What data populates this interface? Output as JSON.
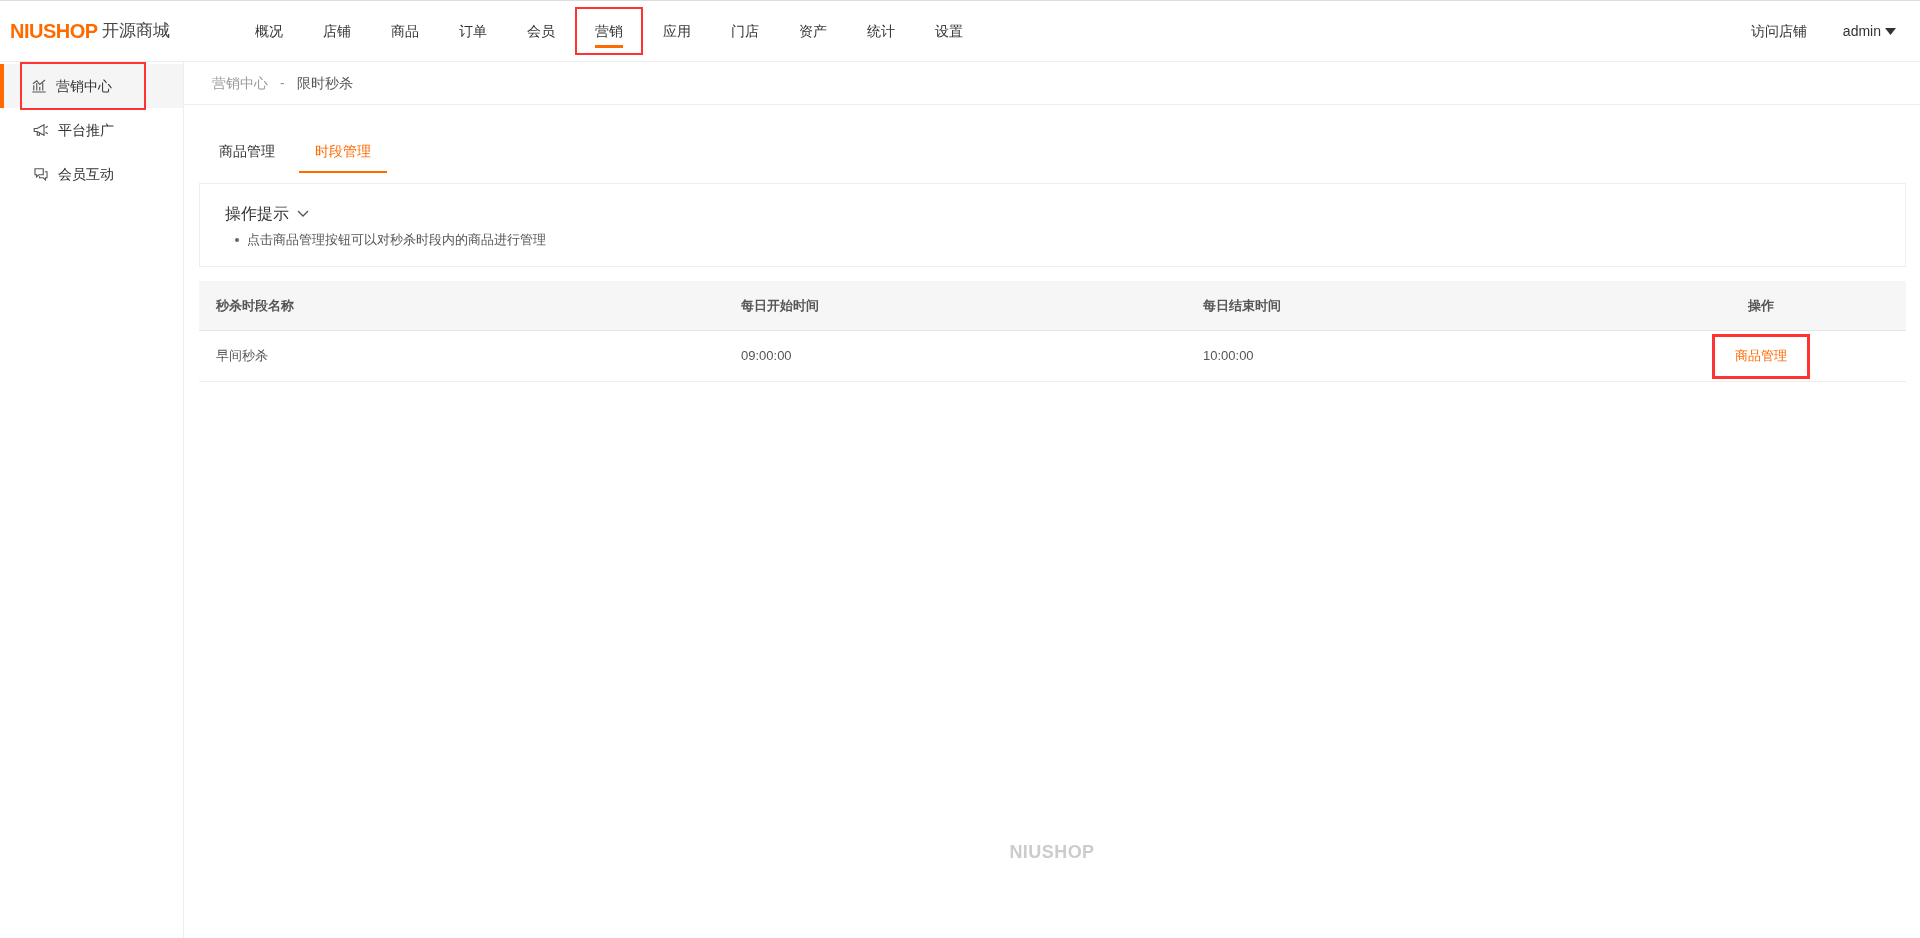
{
  "header": {
    "logo": {
      "brand": "NIUSHOP",
      "name": "开源商城"
    },
    "nav": [
      {
        "label": "概况",
        "selected": false,
        "highlighted": false
      },
      {
        "label": "店铺",
        "selected": false,
        "highlighted": false
      },
      {
        "label": "商品",
        "selected": false,
        "highlighted": false
      },
      {
        "label": "订单",
        "selected": false,
        "highlighted": false
      },
      {
        "label": "会员",
        "selected": false,
        "highlighted": false
      },
      {
        "label": "营销",
        "selected": true,
        "highlighted": true
      },
      {
        "label": "应用",
        "selected": false,
        "highlighted": false
      },
      {
        "label": "门店",
        "selected": false,
        "highlighted": false
      },
      {
        "label": "资产",
        "selected": false,
        "highlighted": false
      },
      {
        "label": "统计",
        "selected": false,
        "highlighted": false
      },
      {
        "label": "设置",
        "selected": false,
        "highlighted": false
      }
    ],
    "visit_store": "访问店铺",
    "user": "admin"
  },
  "sidebar": {
    "items": [
      {
        "label": "营销中心",
        "kind": "chart",
        "selected": true,
        "highlighted": true
      },
      {
        "label": "平台推广",
        "kind": "megaphone",
        "selected": false,
        "highlighted": false
      },
      {
        "label": "会员互动",
        "kind": "chat",
        "selected": false,
        "highlighted": false
      }
    ]
  },
  "breadcrumb": [
    "营销中心",
    "-",
    "限时秒杀"
  ],
  "tabs": [
    {
      "label": "商品管理",
      "selected": false
    },
    {
      "label": "时段管理",
      "selected": true
    }
  ],
  "tips": {
    "title": "操作提示",
    "expanded": true,
    "items": [
      "点击商品管理按钮可以对秒杀时段内的商品进行管理"
    ]
  },
  "table": {
    "columns": [
      "秒杀时段名称",
      "每日开始时间",
      "每日结束时间",
      "操作"
    ],
    "rows": [
      {
        "name": "早间秒杀",
        "start": "09:00:00",
        "end": "10:00:00",
        "action": {
          "label": "商品管理",
          "highlighted": true
        }
      }
    ]
  },
  "footer": {
    "brand": "NIUSHOP"
  }
}
